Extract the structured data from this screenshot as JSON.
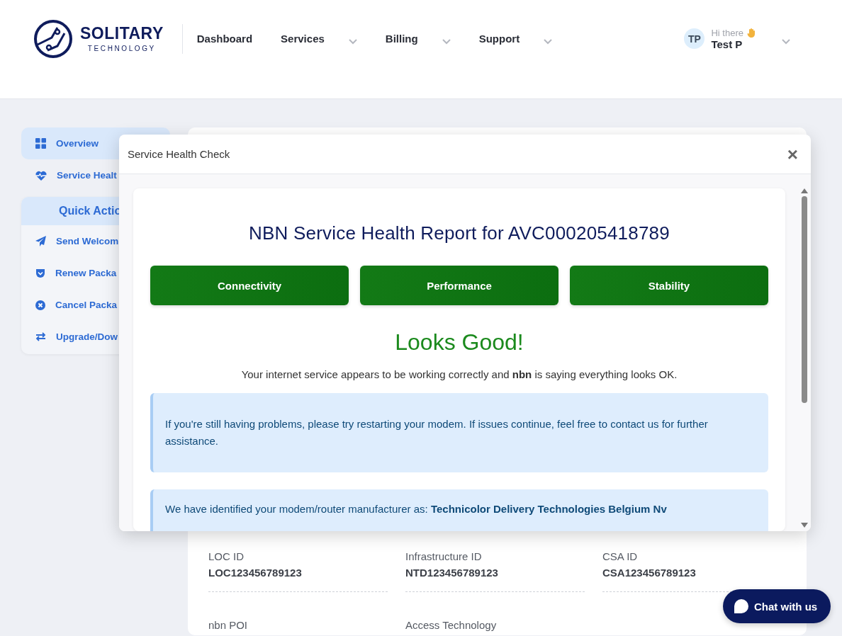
{
  "header": {
    "brand": {
      "name": "SOLITARY",
      "tagline": "TECHNOLOGY"
    },
    "nav": [
      {
        "label": "Dashboard",
        "dropdown": false
      },
      {
        "label": "Services",
        "dropdown": true
      },
      {
        "label": "Billing",
        "dropdown": true
      },
      {
        "label": "Support",
        "dropdown": true
      }
    ],
    "user": {
      "initials": "TP",
      "greeting": "Hi there",
      "name": "Test P"
    }
  },
  "sidebar": {
    "items": [
      {
        "label": "Overview",
        "selected": true
      },
      {
        "label": "Service Healt",
        "selected": false
      }
    ],
    "quick_actions": {
      "title": "Quick Actio",
      "items": [
        {
          "label": "Send Welcom"
        },
        {
          "label": "Renew Packa"
        },
        {
          "label": "Cancel Packa"
        },
        {
          "label": "Upgrade/Dow"
        }
      ]
    }
  },
  "details": {
    "fields": [
      {
        "label": "LOC ID",
        "value": "LOC123456789123"
      },
      {
        "label": "Infrastructure ID",
        "value": "NTD123456789123"
      },
      {
        "label": "CSA ID",
        "value": "CSA123456789123"
      },
      {
        "label": "nbn POI"
      },
      {
        "label": "Access Technology"
      }
    ]
  },
  "modal": {
    "title": "Service Health Check",
    "close": "×",
    "report_title": "NBN Service Health Report for AVC000205418789",
    "checks": [
      {
        "label": "Connectivity"
      },
      {
        "label": "Performance"
      },
      {
        "label": "Stability"
      }
    ],
    "verdict": "Looks Good!",
    "summary": "Your internet service appears to be working correctly and **nbn** is saying everything looks OK.",
    "notices": [
      "If you're still having problems, please try restarting your modem. If issues continue, feel free to contact us for further assistance.",
      "We have identified your modem/router manufacturer as: **Technicolor Delivery Technologies Belgium Nv**"
    ]
  },
  "chat": {
    "label": "Chat with us"
  }
}
